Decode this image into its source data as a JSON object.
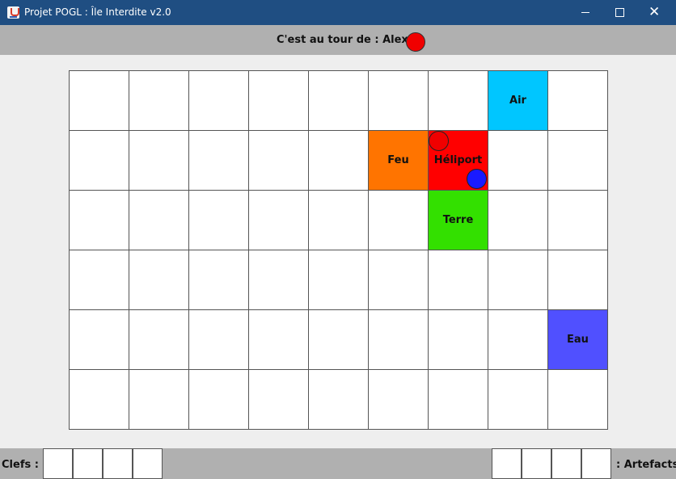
{
  "window": {
    "title": "Projet POGL : Île Interdite v2.0",
    "icon": "java-cup-icon",
    "controls": {
      "minimize": "minimize-icon",
      "maximize": "maximize-icon",
      "close": "✕"
    }
  },
  "turn": {
    "label": "C'est au tour de : Alex",
    "token_color": "#f00000"
  },
  "board": {
    "columns": 9,
    "rows": 6,
    "cells": [
      [
        "",
        "",
        "",
        "",
        "",
        "",
        "",
        "Air",
        ""
      ],
      [
        "",
        "",
        "",
        "",
        "",
        "Feu",
        "Héliport",
        "",
        ""
      ],
      [
        "",
        "",
        "",
        "",
        "",
        "",
        "Terre",
        "",
        ""
      ],
      [
        "",
        "",
        "",
        "",
        "",
        "",
        "",
        "",
        ""
      ],
      [
        "",
        "",
        "",
        "",
        "",
        "",
        "",
        "",
        "Eau"
      ],
      [
        "",
        "",
        "",
        "",
        "",
        "",
        "",
        "",
        ""
      ]
    ],
    "cell_colors": {
      "Air": "#00c6ff",
      "Feu": "#ff7400",
      "Héliport": "#ff0000",
      "Terre": "#33e000",
      "Eau": "#5050ff"
    },
    "players": [
      {
        "color": "#f00000",
        "cell": [
          1,
          6
        ],
        "corner": "top-left"
      },
      {
        "color": "#1a1aff",
        "cell": [
          1,
          6
        ],
        "corner": "bottom-right"
      }
    ]
  },
  "inventory": {
    "keys_label": "Clefs :",
    "artefacts_label": ": Artefacts",
    "key_slots": [
      "",
      "",
      "",
      ""
    ],
    "artefact_slots": [
      "",
      "",
      "",
      ""
    ]
  }
}
